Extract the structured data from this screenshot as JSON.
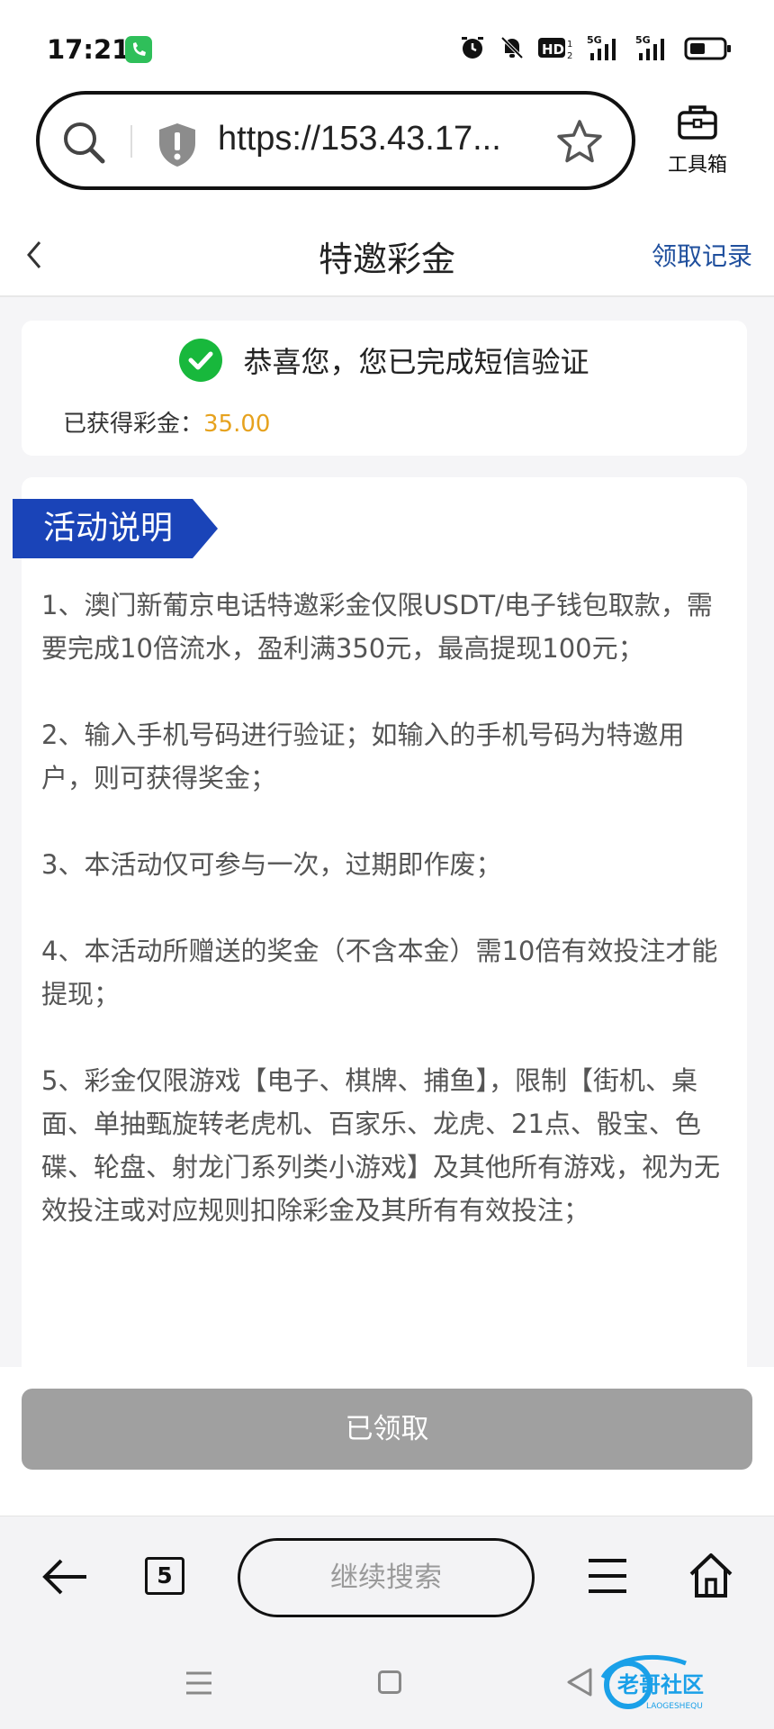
{
  "status_bar": {
    "time": "17:21",
    "icons": [
      "alarm-icon",
      "mute-icon",
      "hd-icon",
      "signal-5g-icon",
      "signal-5g-icon",
      "battery-icon"
    ],
    "hd_label": "HD",
    "net_label": "5G"
  },
  "browser": {
    "url": "https://153.43.17...",
    "toolbox_label": "工具箱"
  },
  "header": {
    "title": "特邀彩金",
    "right_link": "领取记录"
  },
  "success": {
    "message": "恭喜您，您已完成短信验证",
    "bonus_label": "已获得彩金：",
    "bonus_value": "35.00"
  },
  "rules": {
    "tag": "活动说明",
    "items": [
      "1、澳门新葡京电话特邀彩金仅限USDT/电子钱包取款，需要完成10倍流水，盈利满350元，最高提现100元；",
      "2、输入手机号码进行验证；如输入的手机号码为特邀用户，则可获得奖金；",
      "3、本活动仅可参与一次，过期即作废；",
      "4、本活动所赠送的奖金（不含本金）需10倍有效投注才能提现；",
      "5、彩金仅限游戏【电子、棋牌、捕鱼】，限制【街机、桌面、单抽甄旋转老虎机、百家乐、龙虎、21点、骰宝、色碟、轮盘、射龙门系列类小游戏】及其他所有游戏，视为无效投注或对应规则扣除彩金及其所有有效投注；"
    ]
  },
  "claim_button": "已领取",
  "browser_bottom": {
    "tab_count": "5",
    "search_label": "继续搜索"
  },
  "watermark": {
    "text": "老哥社区",
    "sub": "LAOGESHEQU"
  },
  "colors": {
    "accent_blue": "#1a44b8",
    "link_blue": "#1f4f9d",
    "bonus_gold": "#e6a21e",
    "success_green": "#18b83c",
    "disabled_gray": "#a0a0a0"
  }
}
